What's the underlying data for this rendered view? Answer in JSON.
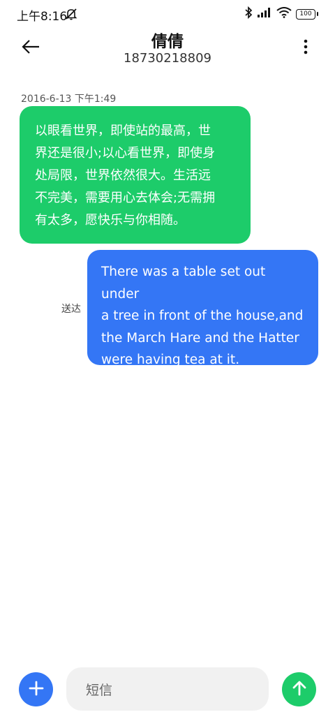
{
  "status_bar": {
    "time": "上午8:16",
    "battery": "100",
    "icons": [
      "mute-icon",
      "bluetooth-icon",
      "signal-icon",
      "wifi-icon",
      "battery-icon"
    ]
  },
  "header": {
    "contact_name": "倩倩",
    "contact_number": "18730218809",
    "back_icon": "back-arrow-icon",
    "more_icon": "more-vertical-icon"
  },
  "conversation": {
    "timestamp": "2016-6-13 下午1:49",
    "messages": [
      {
        "direction": "received",
        "text": "以眼看世界，即使站的最高，世界还是很小;以心看世界，即使身处局限，世界依然很大。生活远不完美，需要用心去体会;无需拥有太多，愿快乐与你相随。",
        "lines": [
          "以眼看世界，即使站的最高，世",
          "界还是很小;以心看世界，即使身",
          "处局限，世界依然很大。生活远",
          "不完美，需要用心去体会;无需拥",
          "有太多，愿快乐与你相随。"
        ]
      },
      {
        "direction": "sent",
        "text": "There was a table set out under a tree in front of the house,and the March Hare and the Hatter were having tea at it.",
        "lines": [
          "There was a table set out under",
          "a tree in front of the house,and",
          "the March Hare and the Hatter",
          "were having tea at it."
        ],
        "status": "送达"
      }
    ]
  },
  "composer": {
    "placeholder": "短信",
    "add_icon": "plus-icon",
    "send_icon": "send-arrow-up-icon"
  },
  "colors": {
    "received_bubble": "#1dcc6a",
    "sent_bubble": "#3476f5",
    "add_button": "#3476f5",
    "send_button": "#1dcc6a",
    "input_background": "#f1f1f1"
  }
}
